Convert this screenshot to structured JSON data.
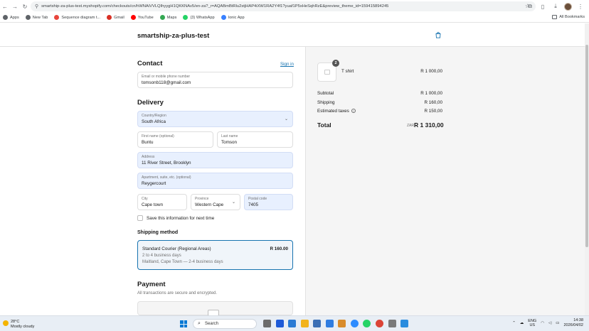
{
  "browser": {
    "url": "smartship-za-plus-test.myshopify.com/checkouts/cn/hWNAiVVLQIhyygH1QKKNAv5/en-za?_r=AQABmBtRlu2stjHAP4iXW1RA2Y4f1?yuaf1P5xHeSqhRzE&preview_theme_id=159415894245",
    "bookmarks": [
      {
        "label": "Apps",
        "color": "#5f6368"
      },
      {
        "label": "New Tab",
        "color": "#5f6368"
      },
      {
        "label": "Sequence diagram t...",
        "color": "#e8453c"
      },
      {
        "label": "Gmail",
        "color": "#d93025"
      },
      {
        "label": "YouTube",
        "color": "#ff0000"
      },
      {
        "label": "Maps",
        "color": "#34a853"
      },
      {
        "label": "(3) WhatsApp",
        "color": "#25d366"
      },
      {
        "label": "Ionic App",
        "color": "#3880ff"
      }
    ],
    "all_bookmarks": "All Bookmarks"
  },
  "store": {
    "name": "smartship-za-plus-test"
  },
  "contact": {
    "title": "Contact",
    "sign_in": "Sign in",
    "email_label": "Email or mobile phone number",
    "email_value": "tomsonb118@gmail.com"
  },
  "delivery": {
    "title": "Delivery",
    "country_label": "Country/Region",
    "country_value": "South Africa",
    "first_name_label": "First name (optional)",
    "first_name_value": "Buntu",
    "last_name_label": "Last name",
    "last_name_value": "Tomson",
    "address_label": "Address",
    "address_value": "11 River Street, Brooklyn",
    "apartment_label": "Apartment, suite, etc. (optional)",
    "apartment_value": "Reygercourt",
    "city_label": "City",
    "city_value": "Cape town",
    "province_label": "Province",
    "province_value": "Western Cape",
    "postal_label": "Postal code",
    "postal_value": "7405",
    "save_info": "Save this information for next time"
  },
  "shipping": {
    "title": "Shipping method",
    "option_name": "Standard Courier (Regional Areas)",
    "option_price": "R 160.00",
    "option_days": "2 to 4 business days",
    "option_location": "Maitland, Cape Town — 2-4 business days"
  },
  "payment": {
    "title": "Payment",
    "note": "All transactions are secure and encrypted."
  },
  "summary": {
    "item_name": "T shirt",
    "item_qty": "2",
    "item_price": "R 1 000,00",
    "subtotal_label": "Subtotal",
    "subtotal_value": "R 1 000,00",
    "shipping_label": "Shipping",
    "shipping_value": "R 160,00",
    "taxes_label": "Estimated taxes",
    "taxes_value": "R 150,00",
    "total_label": "Total",
    "total_currency": "ZAR",
    "total_value": "R 1 310,00"
  },
  "taskbar": {
    "temp": "28°C",
    "weather": "Mostly cloudy",
    "search": "Search",
    "lang_top": "ENG",
    "lang_bottom": "US",
    "time": "14:38",
    "date": "2026/04/02"
  },
  "colors": {
    "accent": "#1773b0",
    "autofill": "#e8f0fe"
  }
}
